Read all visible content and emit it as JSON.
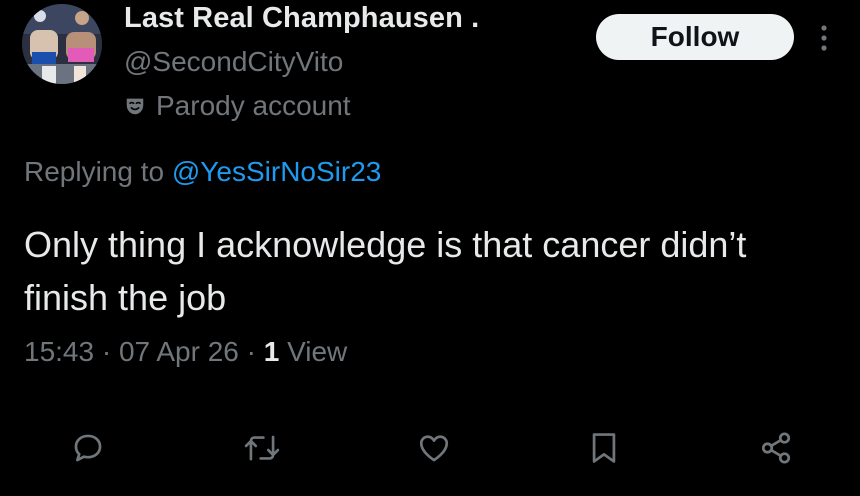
{
  "author": {
    "display_name": "Last Real Champhausen .",
    "handle": "@SecondCityVito",
    "label": "Parody account"
  },
  "follow_button": {
    "label": "Follow"
  },
  "reply": {
    "prefix": "Replying to ",
    "mention": "@YesSirNoSir23"
  },
  "tweet": {
    "text": "Only thing I acknowledge is that cancer didn’t finish the job"
  },
  "meta": {
    "time": "15:43",
    "separator": " · ",
    "date": "07 Apr 26",
    "views_count": "1",
    "views_label": " View"
  },
  "icons": {
    "avatar": "avatar-photo",
    "parody": "theater-mask-icon",
    "more": "more-vertical-icon",
    "reply": "reply-icon",
    "repost": "repost-icon",
    "like": "heart-icon",
    "bookmark": "bookmark-icon",
    "share": "share-icon"
  },
  "colors": {
    "background": "#000000",
    "primary_text": "#e7e9ea",
    "secondary_text": "#71767b",
    "link": "#1d9bf0",
    "follow_bg": "#eff3f4"
  }
}
